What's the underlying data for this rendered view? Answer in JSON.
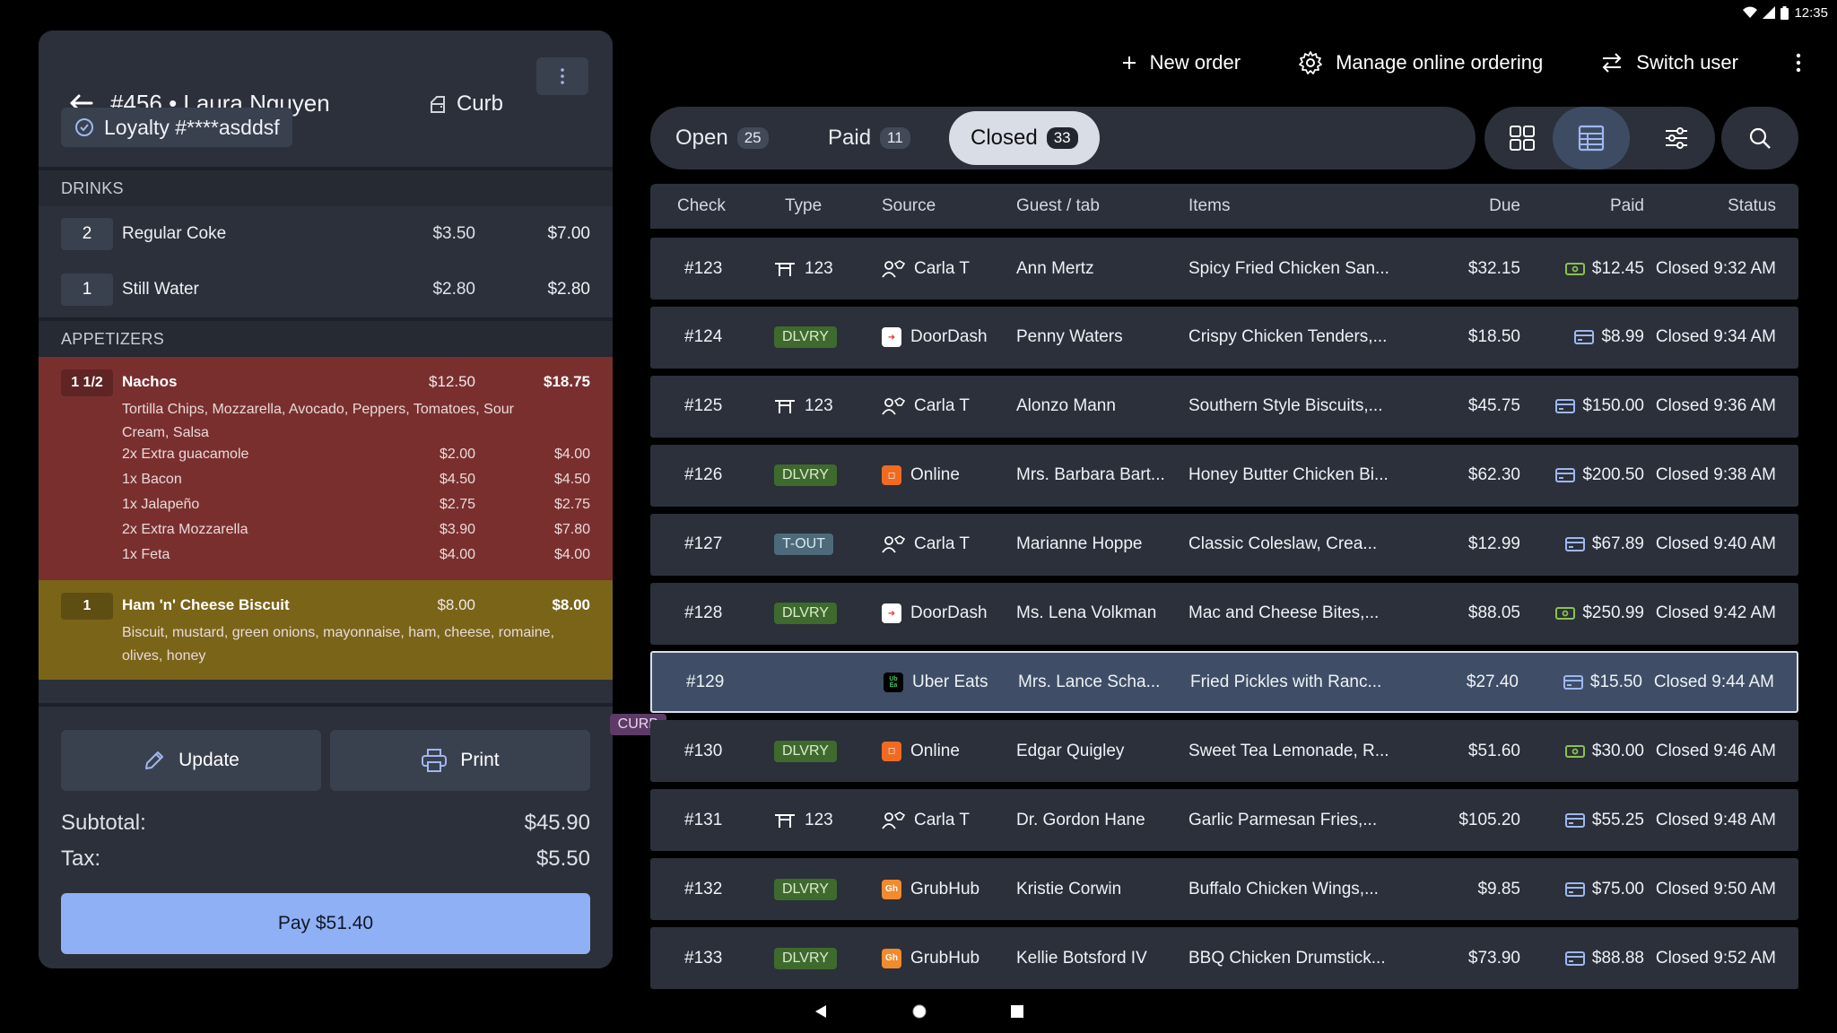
{
  "status": {
    "time": "12:35"
  },
  "order": {
    "title": "#456 • Laura Nguyen",
    "type_label": "Curb",
    "loyalty": "Loyalty #****asddsf",
    "sections": {
      "drinks": "DRINKS",
      "appetizers": "APPETIZERS"
    },
    "drinks": [
      {
        "qty": "2",
        "name": "Regular Coke",
        "price": "$3.50",
        "total": "$7.00"
      },
      {
        "qty": "1",
        "name": "Still Water",
        "price": "$2.80",
        "total": "$2.80"
      }
    ],
    "nachos": {
      "qty": "1 1/2",
      "name": "Nachos",
      "price": "$12.50",
      "total": "$18.75",
      "desc": "Tortilla Chips, Mozzarella, Avocado, Peppers, Tomatoes, Sour Cream, Salsa",
      "mods": [
        {
          "name": "2x Extra guacamole",
          "price": "$2.00",
          "total": "$4.00"
        },
        {
          "name": "1x Bacon",
          "price": "$4.50",
          "total": "$4.50"
        },
        {
          "name": "1x Jalapeño",
          "price": "$2.75",
          "total": "$2.75"
        },
        {
          "name": "2x Extra Mozzarella",
          "price": "$3.90",
          "total": "$7.80"
        },
        {
          "name": "1x Feta",
          "price": "$4.00",
          "total": "$4.00"
        }
      ]
    },
    "biscuit": {
      "qty": "1",
      "name": "Ham 'n' Cheese Biscuit",
      "price": "$8.00",
      "total": "$8.00",
      "desc": "Biscuit, mustard, green onions, mayonnaise, ham, cheese, romaine, olives, honey"
    },
    "update_label": "Update",
    "print_label": "Print",
    "subtotal_label": "Subtotal:",
    "subtotal": "$45.90",
    "tax_label": "Tax:",
    "tax": "$5.50",
    "pay_label": "Pay $51.40"
  },
  "actions": {
    "new_order": "New order",
    "manage": "Manage online ordering",
    "switch_user": "Switch user"
  },
  "tabs": [
    {
      "label": "Open",
      "count": "25"
    },
    {
      "label": "Paid",
      "count": "11"
    },
    {
      "label": "Closed",
      "count": "33"
    }
  ],
  "columns": [
    "Check",
    "Type",
    "Source",
    "Guest / tab",
    "Items",
    "Due",
    "Paid",
    "Status"
  ],
  "rows": [
    {
      "check": "#123",
      "type": "123",
      "type_kind": "table",
      "source": "Carla T",
      "source_kind": "staff",
      "guest": "Ann Mertz",
      "items": "Spicy Fried Chicken San...",
      "due": "$32.15",
      "paid": "$12.45",
      "paid_kind": "cash",
      "status": "Closed 9:32 AM"
    },
    {
      "check": "#124",
      "type": "DLVRY",
      "type_kind": "dlvry",
      "source": "DoorDash",
      "source_kind": "doordash",
      "guest": "Penny Waters",
      "items": "Crispy Chicken Tenders,...",
      "due": "$18.50",
      "paid": "$8.99",
      "paid_kind": "card",
      "status": "Closed 9:34 AM"
    },
    {
      "check": "#125",
      "type": "123",
      "type_kind": "table",
      "source": "Carla T",
      "source_kind": "staff",
      "guest": "Alonzo Mann",
      "items": "Southern Style Biscuits,...",
      "due": "$45.75",
      "paid": "$150.00",
      "paid_kind": "card",
      "status": "Closed 9:36 AM"
    },
    {
      "check": "#126",
      "type": "DLVRY",
      "type_kind": "dlvry",
      "source": "Online",
      "source_kind": "online",
      "guest": "Mrs. Barbara Bart...",
      "items": "Honey Butter Chicken Bi...",
      "due": "$62.30",
      "paid": "$200.50",
      "paid_kind": "card",
      "status": "Closed 9:38 AM"
    },
    {
      "check": "#127",
      "type": "T-OUT",
      "type_kind": "tout",
      "source": "Carla T",
      "source_kind": "staff",
      "guest": "Marianne Hoppe",
      "items": "Classic Coleslaw, Crea...",
      "due": "$12.99",
      "paid": "$67.89",
      "paid_kind": "card",
      "status": "Closed 9:40 AM"
    },
    {
      "check": "#128",
      "type": "DLVRY",
      "type_kind": "dlvry",
      "source": "DoorDash",
      "source_kind": "doordash",
      "guest": "Ms. Lena Volkman",
      "items": "Mac and Cheese Bites,...",
      "due": "$88.05",
      "paid": "$250.99",
      "paid_kind": "cash",
      "status": "Closed 9:42 AM"
    },
    {
      "check": "#129",
      "type": "CURB",
      "type_kind": "curb",
      "source": "Uber Eats",
      "source_kind": "uber",
      "guest": "Mrs. Lance Scha...",
      "items": "Fried Pickles with Ranc...",
      "due": "$27.40",
      "paid": "$15.50",
      "paid_kind": "card",
      "status": "Closed 9:44 AM"
    },
    {
      "check": "#130",
      "type": "DLVRY",
      "type_kind": "dlvry",
      "source": "Online",
      "source_kind": "online",
      "guest": "Edgar Quigley",
      "items": "Sweet Tea Lemonade, R...",
      "due": "$51.60",
      "paid": "$30.00",
      "paid_kind": "cash",
      "status": "Closed 9:46 AM"
    },
    {
      "check": "#131",
      "type": "123",
      "type_kind": "table",
      "source": "Carla T",
      "source_kind": "staff",
      "guest": "Dr. Gordon Hane",
      "items": "Garlic Parmesan Fries,...",
      "due": "$105.20",
      "paid": "$55.25",
      "paid_kind": "card",
      "status": "Closed 9:48 AM"
    },
    {
      "check": "#132",
      "type": "DLVRY",
      "type_kind": "dlvry",
      "source": "GrubHub",
      "source_kind": "grubhub",
      "guest": "Kristie Corwin",
      "items": "Buffalo Chicken Wings,...",
      "due": "$9.85",
      "paid": "$75.00",
      "paid_kind": "card",
      "status": "Closed 9:50 AM"
    },
    {
      "check": "#133",
      "type": "DLVRY",
      "type_kind": "dlvry",
      "source": "GrubHub",
      "source_kind": "grubhub",
      "guest": "Kellie Botsford IV",
      "items": "BBQ Chicken Drumstick...",
      "due": "$73.90",
      "paid": "$88.88",
      "paid_kind": "card",
      "status": "Closed 9:52 AM"
    }
  ]
}
